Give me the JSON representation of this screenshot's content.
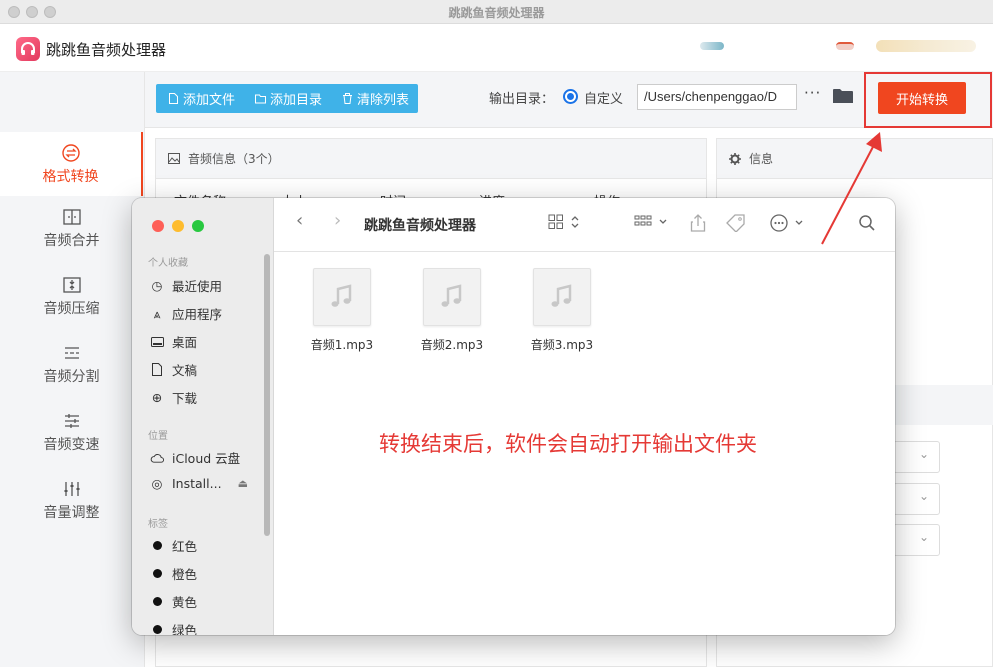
{
  "window": {
    "title": "跳跳鱼音频处理器"
  },
  "app": {
    "name": "跳跳鱼音频处理器"
  },
  "toolbar": {
    "add_file": "添加文件",
    "add_folder": "添加目录",
    "clear_list": "清除列表",
    "output_label": "输出目录：",
    "radio_custom": "自定义",
    "output_path": "/Users/chenpenggao/D",
    "more": "···",
    "start": "开始转换"
  },
  "sidebar": {
    "items": [
      {
        "label": "格式转换",
        "icon": "format-convert-icon",
        "active": true
      },
      {
        "label": "音频合并",
        "icon": "merge-icon"
      },
      {
        "label": "音频压缩",
        "icon": "compress-icon"
      },
      {
        "label": "音频分割",
        "icon": "split-icon"
      },
      {
        "label": "音频变速",
        "icon": "speed-icon"
      },
      {
        "label": "音量调整",
        "icon": "volume-icon"
      }
    ]
  },
  "file_panel": {
    "title": "音频信息（3个）",
    "columns": [
      "文件名称",
      "大小",
      "时间",
      "进度",
      "操作"
    ]
  },
  "info_panel": {
    "title": "信息"
  },
  "annotation": "转换结束后，软件会自动打开输出文件夹",
  "finder": {
    "title": "跳跳鱼音频处理器",
    "favorites_label": "个人收藏",
    "favorites": [
      "最近使用",
      "应用程序",
      "桌面",
      "文稿",
      "下载"
    ],
    "locations_label": "位置",
    "locations": [
      "iCloud 云盘",
      "Install..."
    ],
    "tags_label": "标签",
    "tags": [
      "红色",
      "橙色",
      "黄色",
      "绿色"
    ],
    "files": [
      "音频1.mp3",
      "音频2.mp3",
      "音频3.mp3"
    ]
  },
  "colors": {
    "accent": "#f0461f",
    "toolbar_blue": "#3fb2e8",
    "annotation_red": "#e53935"
  }
}
